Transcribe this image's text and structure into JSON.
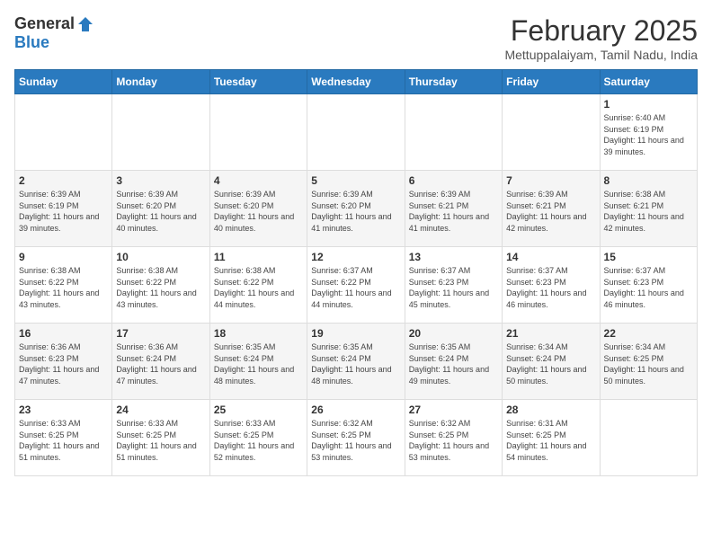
{
  "header": {
    "logo_general": "General",
    "logo_blue": "Blue",
    "month_title": "February 2025",
    "location": "Mettuppalaiyam, Tamil Nadu, India"
  },
  "weekdays": [
    "Sunday",
    "Monday",
    "Tuesday",
    "Wednesday",
    "Thursday",
    "Friday",
    "Saturday"
  ],
  "weeks": [
    [
      {
        "day": "",
        "sunrise": "",
        "sunset": "",
        "daylight": ""
      },
      {
        "day": "",
        "sunrise": "",
        "sunset": "",
        "daylight": ""
      },
      {
        "day": "",
        "sunrise": "",
        "sunset": "",
        "daylight": ""
      },
      {
        "day": "",
        "sunrise": "",
        "sunset": "",
        "daylight": ""
      },
      {
        "day": "",
        "sunrise": "",
        "sunset": "",
        "daylight": ""
      },
      {
        "day": "",
        "sunrise": "",
        "sunset": "",
        "daylight": ""
      },
      {
        "day": "1",
        "sunrise": "Sunrise: 6:40 AM",
        "sunset": "Sunset: 6:19 PM",
        "daylight": "Daylight: 11 hours and 39 minutes."
      }
    ],
    [
      {
        "day": "2",
        "sunrise": "Sunrise: 6:39 AM",
        "sunset": "Sunset: 6:19 PM",
        "daylight": "Daylight: 11 hours and 39 minutes."
      },
      {
        "day": "3",
        "sunrise": "Sunrise: 6:39 AM",
        "sunset": "Sunset: 6:20 PM",
        "daylight": "Daylight: 11 hours and 40 minutes."
      },
      {
        "day": "4",
        "sunrise": "Sunrise: 6:39 AM",
        "sunset": "Sunset: 6:20 PM",
        "daylight": "Daylight: 11 hours and 40 minutes."
      },
      {
        "day": "5",
        "sunrise": "Sunrise: 6:39 AM",
        "sunset": "Sunset: 6:20 PM",
        "daylight": "Daylight: 11 hours and 41 minutes."
      },
      {
        "day": "6",
        "sunrise": "Sunrise: 6:39 AM",
        "sunset": "Sunset: 6:21 PM",
        "daylight": "Daylight: 11 hours and 41 minutes."
      },
      {
        "day": "7",
        "sunrise": "Sunrise: 6:39 AM",
        "sunset": "Sunset: 6:21 PM",
        "daylight": "Daylight: 11 hours and 42 minutes."
      },
      {
        "day": "8",
        "sunrise": "Sunrise: 6:38 AM",
        "sunset": "Sunset: 6:21 PM",
        "daylight": "Daylight: 11 hours and 42 minutes."
      }
    ],
    [
      {
        "day": "9",
        "sunrise": "Sunrise: 6:38 AM",
        "sunset": "Sunset: 6:22 PM",
        "daylight": "Daylight: 11 hours and 43 minutes."
      },
      {
        "day": "10",
        "sunrise": "Sunrise: 6:38 AM",
        "sunset": "Sunset: 6:22 PM",
        "daylight": "Daylight: 11 hours and 43 minutes."
      },
      {
        "day": "11",
        "sunrise": "Sunrise: 6:38 AM",
        "sunset": "Sunset: 6:22 PM",
        "daylight": "Daylight: 11 hours and 44 minutes."
      },
      {
        "day": "12",
        "sunrise": "Sunrise: 6:37 AM",
        "sunset": "Sunset: 6:22 PM",
        "daylight": "Daylight: 11 hours and 44 minutes."
      },
      {
        "day": "13",
        "sunrise": "Sunrise: 6:37 AM",
        "sunset": "Sunset: 6:23 PM",
        "daylight": "Daylight: 11 hours and 45 minutes."
      },
      {
        "day": "14",
        "sunrise": "Sunrise: 6:37 AM",
        "sunset": "Sunset: 6:23 PM",
        "daylight": "Daylight: 11 hours and 46 minutes."
      },
      {
        "day": "15",
        "sunrise": "Sunrise: 6:37 AM",
        "sunset": "Sunset: 6:23 PM",
        "daylight": "Daylight: 11 hours and 46 minutes."
      }
    ],
    [
      {
        "day": "16",
        "sunrise": "Sunrise: 6:36 AM",
        "sunset": "Sunset: 6:23 PM",
        "daylight": "Daylight: 11 hours and 47 minutes."
      },
      {
        "day": "17",
        "sunrise": "Sunrise: 6:36 AM",
        "sunset": "Sunset: 6:24 PM",
        "daylight": "Daylight: 11 hours and 47 minutes."
      },
      {
        "day": "18",
        "sunrise": "Sunrise: 6:35 AM",
        "sunset": "Sunset: 6:24 PM",
        "daylight": "Daylight: 11 hours and 48 minutes."
      },
      {
        "day": "19",
        "sunrise": "Sunrise: 6:35 AM",
        "sunset": "Sunset: 6:24 PM",
        "daylight": "Daylight: 11 hours and 48 minutes."
      },
      {
        "day": "20",
        "sunrise": "Sunrise: 6:35 AM",
        "sunset": "Sunset: 6:24 PM",
        "daylight": "Daylight: 11 hours and 49 minutes."
      },
      {
        "day": "21",
        "sunrise": "Sunrise: 6:34 AM",
        "sunset": "Sunset: 6:24 PM",
        "daylight": "Daylight: 11 hours and 50 minutes."
      },
      {
        "day": "22",
        "sunrise": "Sunrise: 6:34 AM",
        "sunset": "Sunset: 6:25 PM",
        "daylight": "Daylight: 11 hours and 50 minutes."
      }
    ],
    [
      {
        "day": "23",
        "sunrise": "Sunrise: 6:33 AM",
        "sunset": "Sunset: 6:25 PM",
        "daylight": "Daylight: 11 hours and 51 minutes."
      },
      {
        "day": "24",
        "sunrise": "Sunrise: 6:33 AM",
        "sunset": "Sunset: 6:25 PM",
        "daylight": "Daylight: 11 hours and 51 minutes."
      },
      {
        "day": "25",
        "sunrise": "Sunrise: 6:33 AM",
        "sunset": "Sunset: 6:25 PM",
        "daylight": "Daylight: 11 hours and 52 minutes."
      },
      {
        "day": "26",
        "sunrise": "Sunrise: 6:32 AM",
        "sunset": "Sunset: 6:25 PM",
        "daylight": "Daylight: 11 hours and 53 minutes."
      },
      {
        "day": "27",
        "sunrise": "Sunrise: 6:32 AM",
        "sunset": "Sunset: 6:25 PM",
        "daylight": "Daylight: 11 hours and 53 minutes."
      },
      {
        "day": "28",
        "sunrise": "Sunrise: 6:31 AM",
        "sunset": "Sunset: 6:25 PM",
        "daylight": "Daylight: 11 hours and 54 minutes."
      },
      {
        "day": "",
        "sunrise": "",
        "sunset": "",
        "daylight": ""
      }
    ]
  ]
}
